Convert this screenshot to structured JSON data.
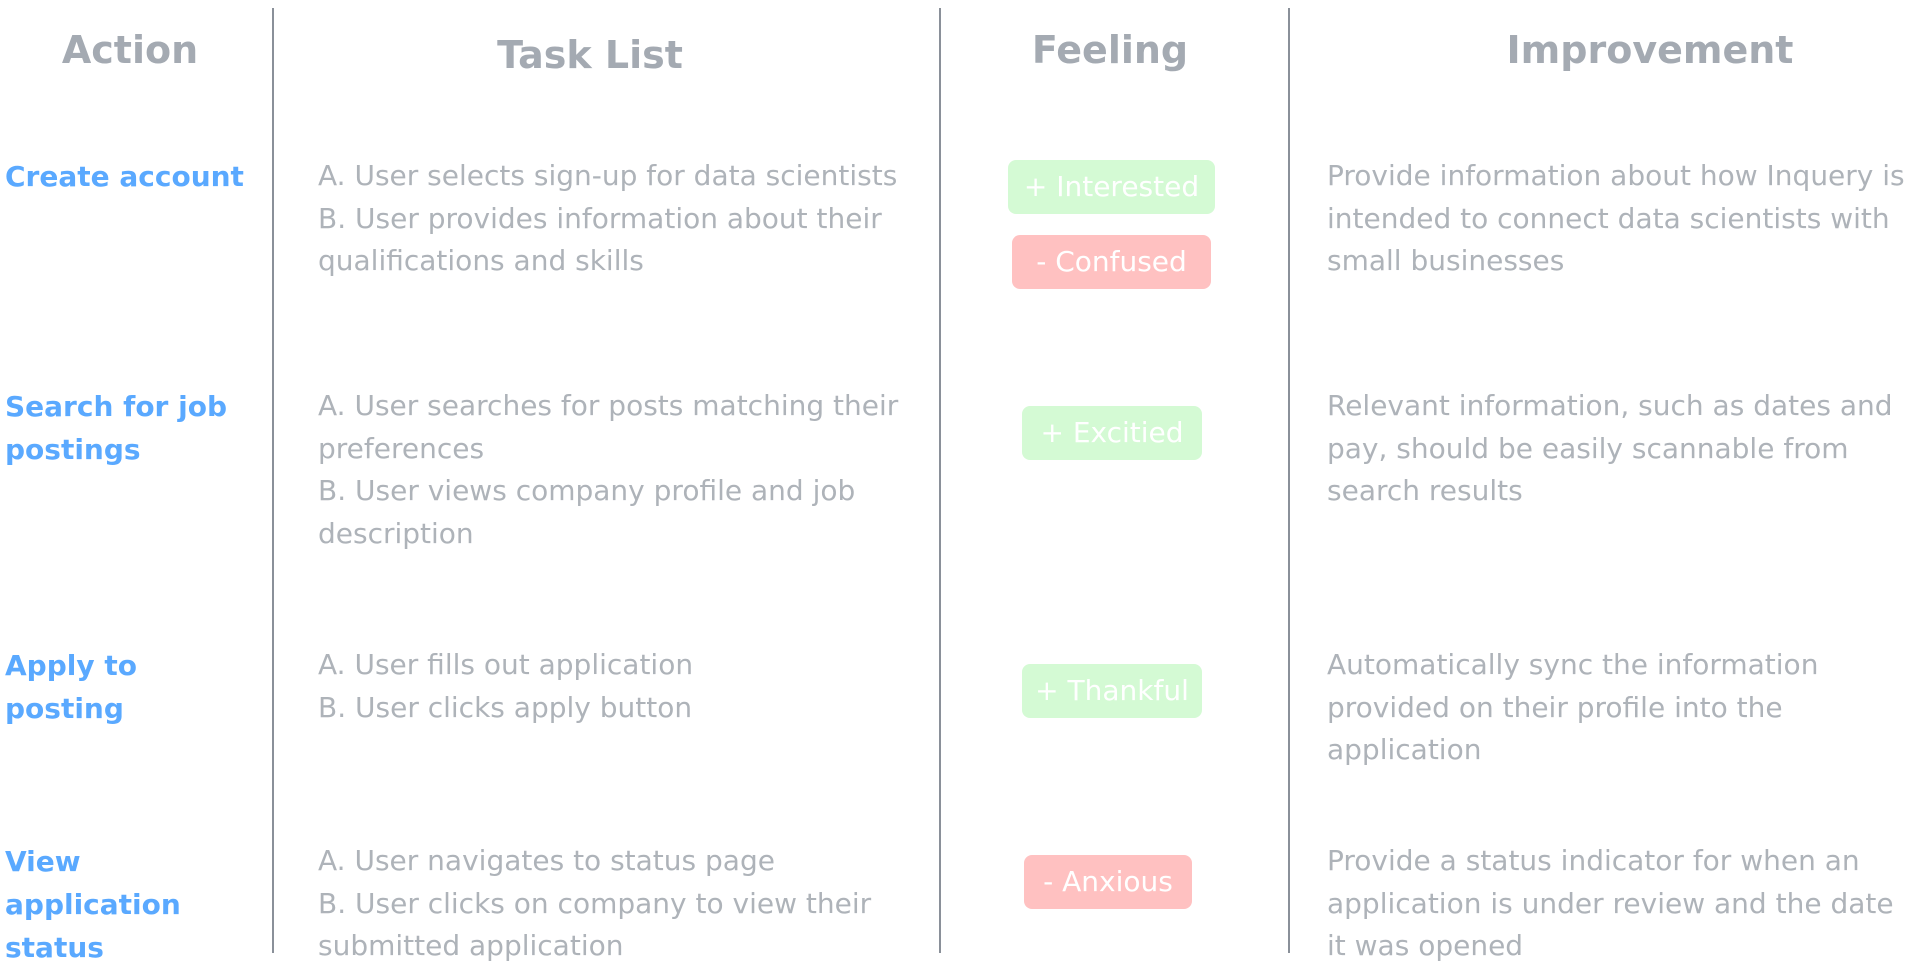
{
  "headers": {
    "action": "Action",
    "task_list": "Task List",
    "feeling": "Feeling",
    "improvement": "Improvement"
  },
  "rows": [
    {
      "action": "Create account",
      "tasks": [
        "A. User selects sign-up for data scientists",
        "B. User provides information about their qualifications and skills"
      ],
      "feelings": [
        {
          "label": "+ Interested",
          "sentiment": "positive"
        },
        {
          "label": "- Confused",
          "sentiment": "negative"
        }
      ],
      "improvement": "Provide information about how Inquery is intended to connect data scientists with small businesses"
    },
    {
      "action": "Search for job postings",
      "tasks": [
        "A. User searches for posts matching their preferences",
        "B. User views company profile and job description"
      ],
      "feelings": [
        {
          "label": "+ Excitied",
          "sentiment": "positive"
        }
      ],
      "improvement": "Relevant information, such as dates and pay, should be easily scannable from search results"
    },
    {
      "action": "Apply to posting",
      "tasks": [
        "A. User fills out application",
        "B. User clicks apply button"
      ],
      "feelings": [
        {
          "label": "+ Thankful",
          "sentiment": "positive"
        }
      ],
      "improvement": "Automatically sync the information provided on their profile into the application"
    },
    {
      "action": "View application status",
      "tasks": [
        "A. User navigates to status page",
        "B. User clicks on company to view their submitted application"
      ],
      "feelings": [
        {
          "label": "- Anxious",
          "sentiment": "negative"
        }
      ],
      "improvement": "Provide a status indicator for when an application is under review and the date it was opened"
    }
  ],
  "colors": {
    "header_text": "#a4aab2",
    "action_text": "#5aa9ff",
    "body_text": "#aeb3b9",
    "divider": "#8a9099",
    "positive_badge": "#d4fad4",
    "negative_badge": "#ffc1c1",
    "badge_text": "#ffffff"
  }
}
